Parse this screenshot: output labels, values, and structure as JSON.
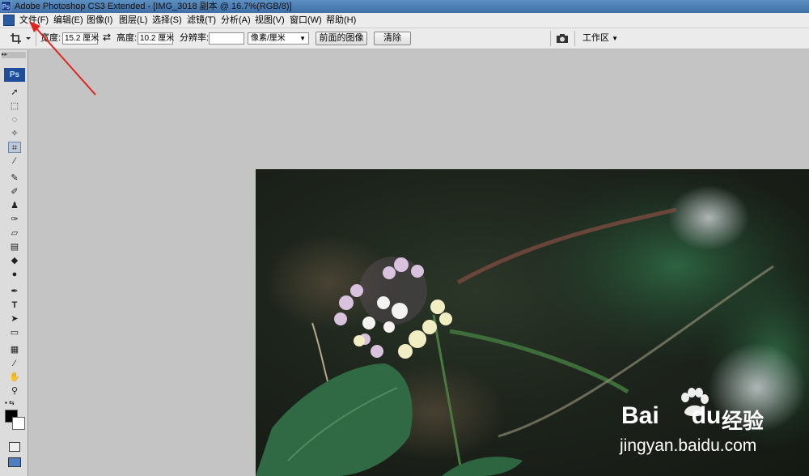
{
  "window": {
    "title": "Adobe Photoshop CS3 Extended - [IMG_3018 副本 @ 16.7%(RGB/8)]",
    "app_icon": "Ps"
  },
  "menu": [
    {
      "label": "文件(F)"
    },
    {
      "label": "编辑(E)"
    },
    {
      "label": "图像(I)"
    },
    {
      "label": "图层(L)"
    },
    {
      "label": "选择(S)"
    },
    {
      "label": "滤镜(T)"
    },
    {
      "label": "分析(A)"
    },
    {
      "label": "视图(V)"
    },
    {
      "label": "窗口(W)"
    },
    {
      "label": "帮助(H)"
    }
  ],
  "options": {
    "width_label": "宽度:",
    "width_value": "15.2 厘米",
    "height_label": "高度:",
    "height_value": "10.2 厘米",
    "resolution_label": "分辨率:",
    "resolution_value": "",
    "unit_value": "像素/厘米",
    "front_image_button": "前面的图像",
    "clear_button": "清除",
    "workspace_label": "工作区"
  },
  "toolbox": {
    "badge": "Ps"
  },
  "watermark": {
    "brand": "Bai",
    "brand_suffix": "du",
    "brand_cn": "经验",
    "url": "jingyan.baidu.com"
  },
  "colors": {
    "arrow": "#e0231b",
    "titlebar": "#4a7bb4",
    "canvas_bg": "#c4c4c4"
  }
}
